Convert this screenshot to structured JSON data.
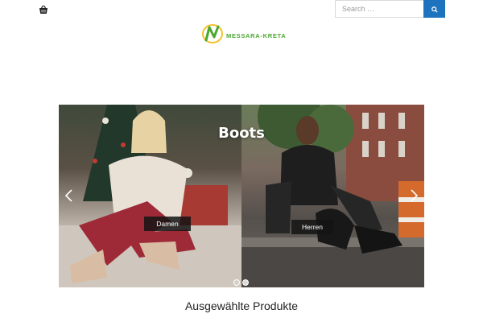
{
  "header": {
    "cart_icon": "shopping-basket-icon",
    "search": {
      "placeholder": "Search …",
      "button_icon": "search-icon"
    }
  },
  "logo": {
    "text": "MESSARA-KRETA",
    "colors": {
      "green": "#4aa82f",
      "yellow": "#f2c22b"
    }
  },
  "slider": {
    "title": "Boots",
    "categories": [
      {
        "label": "Damen"
      },
      {
        "label": "Herren"
      }
    ],
    "prev_icon": "chevron-left-icon",
    "next_icon": "chevron-right-icon",
    "dots": 2,
    "active_dot": 1
  },
  "section": {
    "title": "Ausgewählte Produkte"
  },
  "colors": {
    "accent": "#1e73be"
  }
}
